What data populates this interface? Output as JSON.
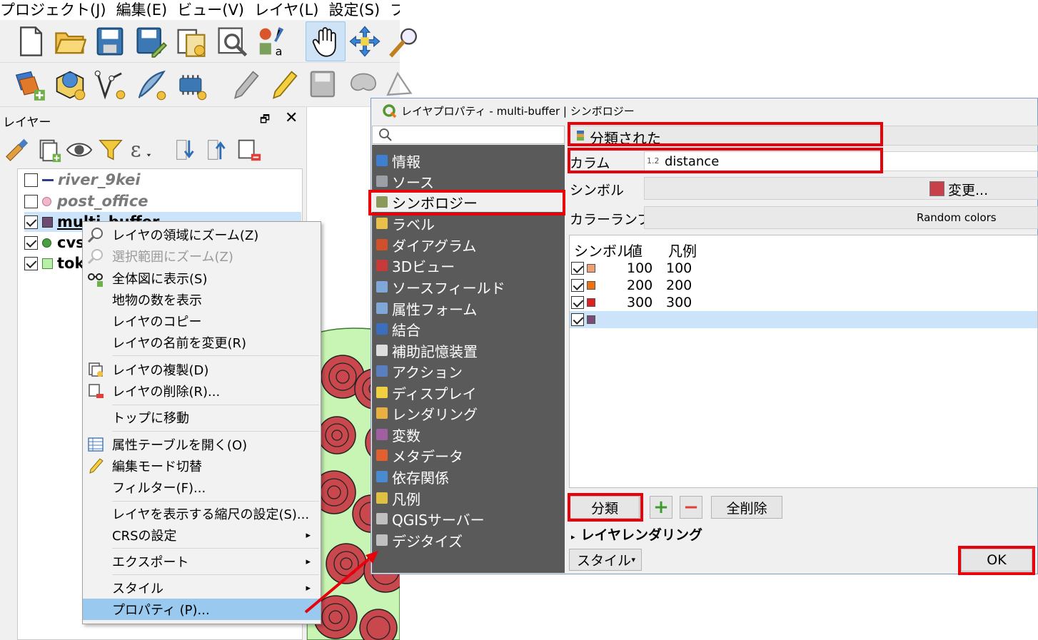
{
  "menubar": [
    "プロジェクト(J)",
    "編集(E)",
    "ビュー(V)",
    "レイヤ(L)",
    "設定(S)",
    "プ"
  ],
  "toolbar_icons": [
    "new-project-icon",
    "open-project-icon",
    "save-project-icon",
    "save-as-icon",
    "new-print-layout-icon",
    "layout-manager-icon",
    "style-manager-icon",
    "pan-map-icon",
    "pan-to-selection-icon",
    "zoom-icon"
  ],
  "toolbar2_icons": [
    "data-source-manager-icon",
    "new-geopackage-layer-icon",
    "digitize-vertex-icon",
    "digitize-freehand-icon",
    "new-temporary-layer-icon",
    "edit-pencil-icon",
    "toggle-edit-icon",
    "save-edits-icon",
    "add-feature-icon",
    "vertex-tool-icon"
  ],
  "layer_panel": {
    "title": "レイヤー",
    "float": "🗗",
    "close": "✕",
    "layers": [
      {
        "name": "river_9kei",
        "checked": false,
        "color": "#2b3f8c",
        "italic": true,
        "grey": true
      },
      {
        "name": "post_office",
        "checked": false,
        "color": "#e0a0b8",
        "italic": true,
        "grey": true
      },
      {
        "name": "multi_buffer",
        "checked": true,
        "color": "#6b4c74",
        "italic": false,
        "grey": false
      },
      {
        "name": "cvs",
        "checked": true,
        "color": "#4aa040",
        "italic": false,
        "grey": false
      },
      {
        "name": "tok",
        "checked": true,
        "color": "#b8f0a8",
        "italic": false,
        "grey": false
      }
    ]
  },
  "context_menu": {
    "items": [
      {
        "label": "レイヤの領域にズーム(Z)",
        "disabled": false
      },
      {
        "label": "選択範囲にズーム(Z)",
        "disabled": true
      },
      {
        "label": "全体図に表示(S)",
        "disabled": false
      },
      {
        "label": "地物の数を表示",
        "disabled": false
      },
      {
        "label": "レイヤのコピー",
        "disabled": false
      },
      {
        "label": "レイヤの名前を変更(R)",
        "disabled": false
      },
      {
        "label": "レイヤの複製(D)",
        "disabled": false
      },
      {
        "label": "レイヤの削除(R)...",
        "disabled": false
      },
      {
        "label": "トップに移動",
        "disabled": false
      },
      {
        "label": "属性テーブルを開く(O)",
        "disabled": false
      },
      {
        "label": "編集モード切替",
        "disabled": false
      },
      {
        "label": "フィルター(F)...",
        "disabled": false
      },
      {
        "label": "レイヤを表示する縮尺の設定(S)...",
        "disabled": false
      },
      {
        "label": "CRSの設定",
        "disabled": false
      },
      {
        "label": "エクスポート",
        "disabled": false
      },
      {
        "label": "スタイル",
        "disabled": false
      },
      {
        "label": "プロパティ (P)...",
        "disabled": false
      }
    ],
    "submenu_arrow": "▸"
  },
  "dialog": {
    "title": "レイヤプロパティ - multi-buffer | シンボロジー",
    "nav": [
      {
        "label": "情報",
        "color": "#3d7fd0"
      },
      {
        "label": "ソース",
        "color": "#9aa0a6"
      },
      {
        "label": "シンボロジー",
        "color": "#8a9a5b"
      },
      {
        "label": "ラベル",
        "color": "#e8c04a"
      },
      {
        "label": "ダイアグラム",
        "color": "#d0502a"
      },
      {
        "label": "3Dビュー",
        "color": "#c83a3a"
      },
      {
        "label": "ソースフィールド",
        "color": "#7fa7d8"
      },
      {
        "label": "属性フォーム",
        "color": "#7fa7d8"
      },
      {
        "label": "結合",
        "color": "#3a6fc0"
      },
      {
        "label": "補助記憶装置",
        "color": "#dddddd"
      },
      {
        "label": "アクション",
        "color": "#5a7fc0"
      },
      {
        "label": "ディスプレイ",
        "color": "#f0d040"
      },
      {
        "label": "レンダリング",
        "color": "#e8b040"
      },
      {
        "label": "変数",
        "color": "#a060a0"
      },
      {
        "label": "メタデータ",
        "color": "#e06030"
      },
      {
        "label": "依存関係",
        "color": "#4a8ad0"
      },
      {
        "label": "凡例",
        "color": "#e0c040"
      },
      {
        "label": "QGISサーバー",
        "color": "#c0c0c0"
      },
      {
        "label": "デジタイズ",
        "color": "#c0c0c0"
      }
    ],
    "renderer": "分類された",
    "column_label": "カラム",
    "column_type": "1.2",
    "column_value": "distance",
    "symbol_label": "シンボル",
    "symbol_color": "#c8404a",
    "change_button": "変更...",
    "ramp_label": "カラーランプ",
    "ramp_value": "Random colors",
    "table_headers": [
      "シンボル",
      "値",
      "凡例"
    ],
    "rows": [
      {
        "value": "100",
        "legend": "100",
        "color": "#f0a070"
      },
      {
        "value": "200",
        "legend": "200",
        "color": "#f07010"
      },
      {
        "value": "300",
        "legend": "300",
        "color": "#e02020"
      },
      {
        "value": "",
        "legend": "",
        "color": "#7a4c7a"
      }
    ],
    "classify_button": "分類",
    "add_button": "+",
    "remove_button": "−",
    "delete_all_button": "全削除",
    "layer_rendering": "レイヤレンダリング",
    "style_button": "スタイル",
    "ok_button": "OK"
  }
}
